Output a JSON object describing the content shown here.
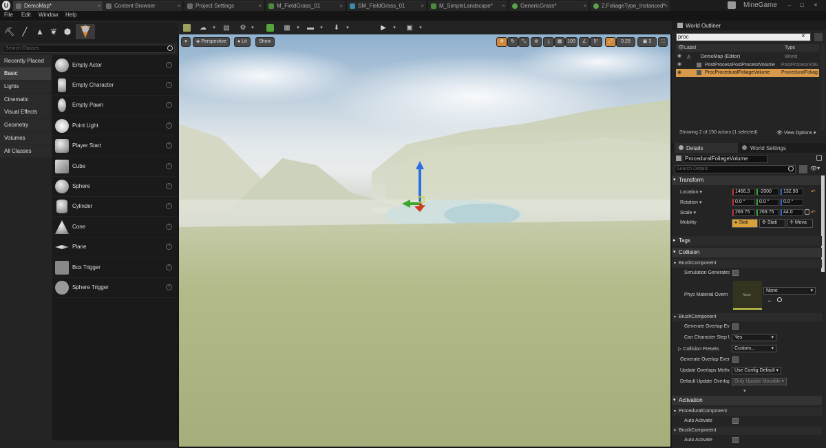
{
  "tabs": [
    {
      "label": "DemoMap*",
      "active": true
    },
    {
      "label": "Content Browser"
    },
    {
      "label": "Project Settings"
    },
    {
      "label": "M_FieldGrass_01"
    },
    {
      "label": "SM_FieldGrass_01"
    },
    {
      "label": "M_SimpleLandscape*"
    },
    {
      "label": "GenericGrass*"
    },
    {
      "label": "2.FoliageType_Instanced*"
    }
  ],
  "app_title": "MineGame",
  "menu": [
    "File",
    "Edit",
    "Window",
    "Help"
  ],
  "modes_panel": {
    "search_placeholder": "Search Classes",
    "categories": [
      "Recently Placed",
      "Basic",
      "Lights",
      "Cinematic",
      "Visual Effects",
      "Geometry",
      "Volumes",
      "All Classes"
    ],
    "selected_category": "Basic",
    "items": [
      "Empty Actor",
      "Empty Character",
      "Empty Pawn",
      "Point Light",
      "Player Start",
      "Cube",
      "Sphere",
      "Cylinder",
      "Cone",
      "Plane",
      "Box Trigger",
      "Sphere Trigger"
    ]
  },
  "viewport": {
    "perspective_label": "Perspective",
    "lit_label": "Lit",
    "show_label": "Show",
    "grid_snap": "100",
    "rot_snap": "5°",
    "scale_snap": "0.25",
    "cam_speed": "3"
  },
  "outliner": {
    "title": "World Outliner",
    "search_value": "proc",
    "col_label": "Label",
    "col_type": "Type",
    "rows": [
      {
        "label": "DemoMap (Editor)",
        "type": "World"
      },
      {
        "label": "PostProcessPostProcessVolume",
        "type": "PostProcessVolu"
      },
      {
        "label": "ProcProceduralFoliageVolume",
        "type": "ProceduralFoliag"
      }
    ],
    "status": "Showing 2 of 150 actors (1 selected)",
    "view_options": "View Options"
  },
  "details": {
    "tab_details": "Details",
    "tab_world_settings": "World Settings",
    "actor_name": "ProceduralFoliageVolume",
    "search_placeholder": "Search Details",
    "transform": "Transform",
    "location_label": "Location",
    "location": [
      "1466.3",
      "-2000",
      "132.90"
    ],
    "rotation_label": "Rotation",
    "rotation": [
      "0.0 °",
      "0.0 °",
      "0.0 °"
    ],
    "scale_label": "Scale",
    "scale": [
      "269.75",
      "269.75",
      "44.0"
    ],
    "mobility_label": "Mobility",
    "mobility": [
      "Stati",
      "Stati",
      "Mova"
    ],
    "tags": "Tags",
    "collision": "Collision",
    "brush_component": "BrushComponent",
    "sim_generates": "Simulation Generates",
    "phys_mat": "Phys Material Overri",
    "phys_thumb": "None",
    "phys_value": "None",
    "gen_overlap": "Generate Overlap Eve",
    "can_step": "Can Character Step U",
    "can_step_value": "Yes",
    "collision_presets": "Collision Presets",
    "collision_presets_value": "Custom...",
    "gen_overlap_events": "Generate Overlap Event",
    "update_overlaps": "Update Overlaps Metho",
    "update_overlaps_value": "Use Config Default",
    "default_update": "Default Update Overlap",
    "default_update_value": "Only Update Movable",
    "activation": "Activation",
    "procedural_component": "ProceduralComponent",
    "auto_activate": "Auto Activate"
  }
}
